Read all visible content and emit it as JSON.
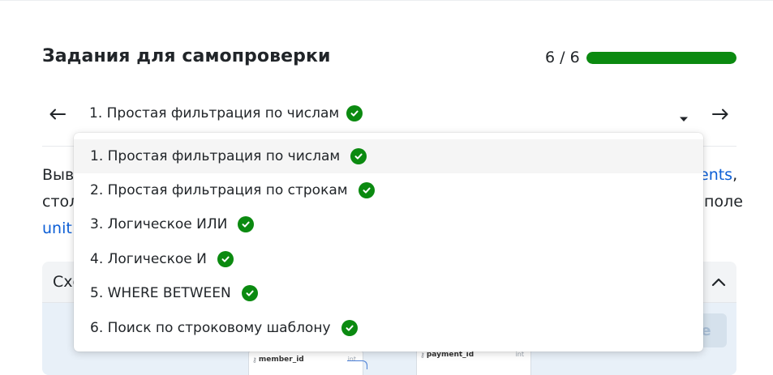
{
  "header": {
    "title": "Задания для самопроверки",
    "progress_text": "6 / 6",
    "progress_fraction": 1.0,
    "progress_color": "#0b8a10"
  },
  "navigator": {
    "current_task": "1. Простая фильтрация по числам",
    "prev_icon": "arrow-left-icon",
    "next_icon": "arrow-right-icon",
    "toggle_icon": "caret-down-icon"
  },
  "dropdown": {
    "items": [
      {
        "label": "1. Простая фильтрация по числам",
        "done": true,
        "selected": true
      },
      {
        "label": "2. Простая фильтрация по строкам",
        "done": true,
        "selected": false
      },
      {
        "label": "3. Логическое ИЛИ",
        "done": true,
        "selected": false
      },
      {
        "label": "4. Логическое И",
        "done": true,
        "selected": false
      },
      {
        "label": "5. WHERE BETWEEN",
        "done": true,
        "selected": false
      },
      {
        "label": "6. Поиск по строковому шаблону",
        "done": true,
        "selected": false
      }
    ]
  },
  "background_text": {
    "line1_start": "Выв",
    "line1_link": "ents",
    "line1_end": ",",
    "line2_start": "стол",
    "line2_end": "поле",
    "line3_link": "unit"
  },
  "schema": {
    "title": "Схе",
    "button_label": "e",
    "tables": [
      {
        "field": "member_id",
        "type": "int"
      },
      {
        "field": "payment_id",
        "type": "int"
      }
    ]
  }
}
